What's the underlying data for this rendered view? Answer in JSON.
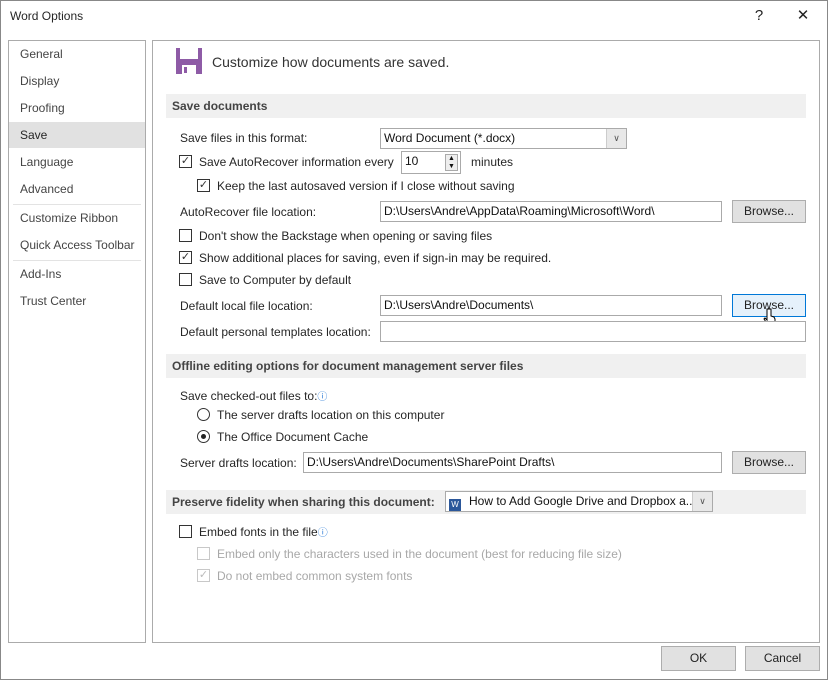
{
  "window": {
    "title": "Word Options",
    "help": "?",
    "close": "✕"
  },
  "sidebar": {
    "items": [
      {
        "label": "General"
      },
      {
        "label": "Display"
      },
      {
        "label": "Proofing"
      },
      {
        "label": "Save",
        "selected": true
      },
      {
        "label": "Language"
      },
      {
        "label": "Advanced"
      },
      {
        "label": "Customize Ribbon"
      },
      {
        "label": "Quick Access Toolbar"
      },
      {
        "label": "Add-Ins"
      },
      {
        "label": "Trust Center"
      }
    ]
  },
  "header": {
    "icon": "floppy-disk-icon",
    "text": "Customize how documents are saved.",
    "accent": "#8e5ba6"
  },
  "save_documents": {
    "title": "Save documents",
    "format_label": "Save files in this format:",
    "format_value": "Word Document (*.docx)",
    "autorecover_label": "Save AutoRecover information every",
    "autorecover_checked": true,
    "autorecover_minutes": "10",
    "minutes_label": "minutes",
    "keep_label": "Keep the last autosaved version if I close without saving",
    "keep_checked": true,
    "ar_location_label": "AutoRecover file location:",
    "ar_location_value": "D:\\Users\\Andre\\AppData\\Roaming\\Microsoft\\Word\\",
    "browse": "Browse...",
    "backstage_label": "Don't show the Backstage when opening or saving files",
    "backstage_checked": false,
    "additional_label": "Show additional places for saving, even if sign-in may be required.",
    "additional_checked": true,
    "computer_label": "Save to Computer by default",
    "computer_checked": false,
    "local_label": "Default local file location:",
    "local_value": "D:\\Users\\Andre\\Documents\\",
    "templates_label": "Default personal templates location:",
    "templates_value": ""
  },
  "offline": {
    "title": "Offline editing options for document management server files",
    "checked_out_label": "Save checked-out files to:",
    "opt1": "The server drafts location on this computer",
    "opt2": "The Office Document Cache",
    "selected": "opt2",
    "drafts_label": "Server drafts location:",
    "drafts_value": "D:\\Users\\Andre\\Documents\\SharePoint Drafts\\",
    "browse": "Browse..."
  },
  "fidelity": {
    "title": "Preserve fidelity when sharing this document:",
    "doc_value": "How to Add Google Drive and Dropbox a...",
    "embed_label": "Embed fonts in the file",
    "embed_checked": false,
    "chars_label": "Embed only the characters used in the document (best for reducing file size)",
    "chars_checked": false,
    "common_label": "Do not embed common system fonts",
    "common_checked": true
  },
  "footer": {
    "ok": "OK",
    "cancel": "Cancel"
  }
}
